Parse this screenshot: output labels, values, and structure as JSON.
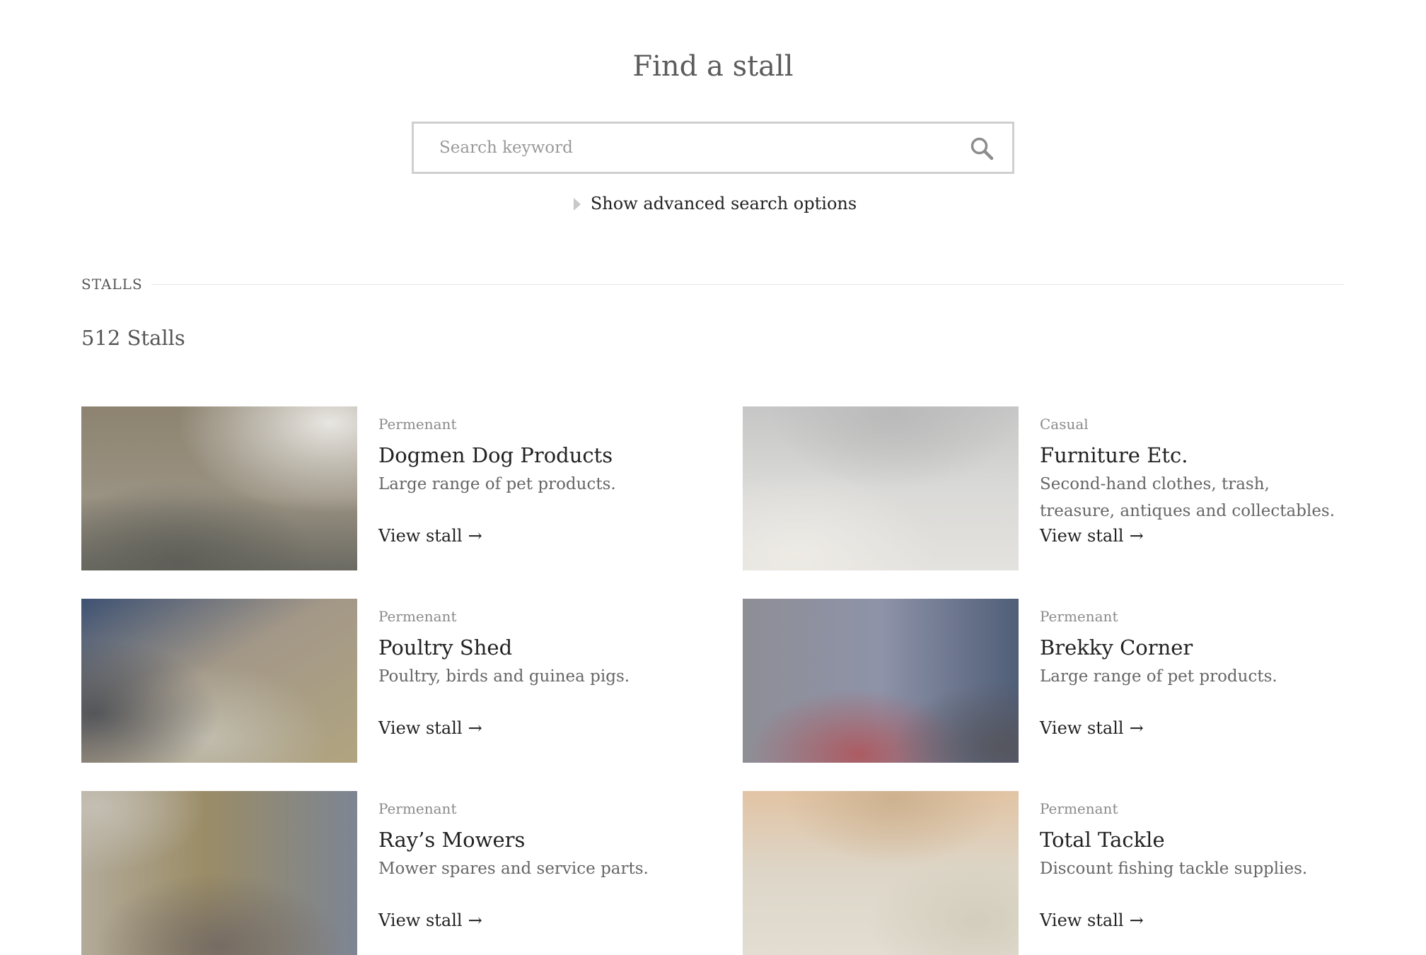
{
  "header": {
    "title": "Find a stall"
  },
  "search": {
    "placeholder": "Search keyword",
    "value": "",
    "icon": "search-icon"
  },
  "advanced": {
    "label": "Show advanced search options",
    "icon": "caret-right-icon"
  },
  "section": {
    "label": "STALLS",
    "count_label": "512 Stalls"
  },
  "stalls": [
    {
      "category": "Permenant",
      "name": "Dogmen Dog Products",
      "description": "Large range of pet products.",
      "link_label": "View stall",
      "link_arrow": "→"
    },
    {
      "category": "Casual",
      "name": "Furniture Etc.",
      "description": "Second-hand clothes, trash, treasure, antiques and collectables.",
      "link_label": "View stall",
      "link_arrow": "→"
    },
    {
      "category": "Permenant",
      "name": "Poultry Shed",
      "description": "Poultry, birds and guinea pigs.",
      "link_label": "View stall",
      "link_arrow": "→"
    },
    {
      "category": "Permenant",
      "name": "Brekky Corner",
      "description": "Large range of pet products.",
      "link_label": "View stall",
      "link_arrow": "→"
    },
    {
      "category": "Permenant",
      "name": "Ray’s Mowers",
      "description": "Mower spares and service parts.",
      "link_label": "View stall",
      "link_arrow": "→"
    },
    {
      "category": "Permenant",
      "name": "Total Tackle",
      "description": "Discount fishing tackle supplies.",
      "link_label": "View stall",
      "link_arrow": "→"
    }
  ],
  "colors": {
    "text_dark": "#222222",
    "text_muted": "#8a8a8a",
    "border": "#cfcfcf"
  }
}
